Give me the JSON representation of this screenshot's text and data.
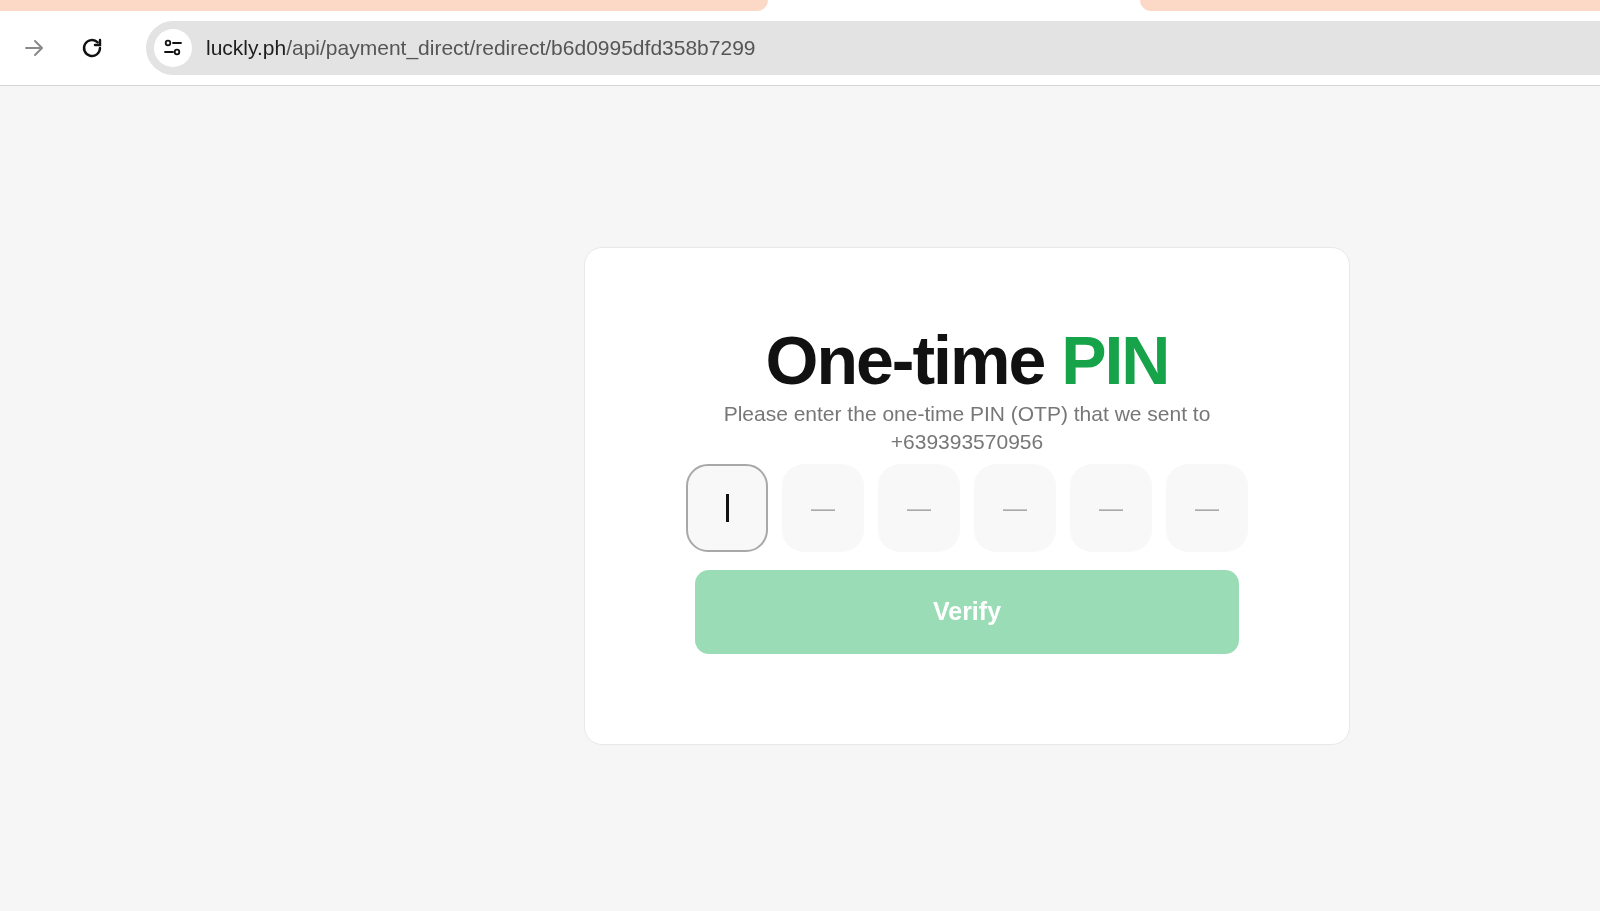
{
  "browser": {
    "address": {
      "domain": "luckly.ph",
      "path": "/api/payment_direct/redirect/b6d0995dfd358b7299"
    },
    "forward_disabled": true
  },
  "otp_card": {
    "title": "One-time",
    "title_highlight": "PIN",
    "instructions": "Please enter the one-time PIN (OTP) that we sent to",
    "phone": "+639393570956",
    "pin_fields": [
      {
        "focused": true
      },
      {
        "focused": false,
        "placeholder": "—"
      },
      {
        "focused": false,
        "placeholder": "—"
      },
      {
        "focused": false,
        "placeholder": "—"
      },
      {
        "focused": false,
        "placeholder": "—"
      },
      {
        "focused": false,
        "placeholder": "—"
      }
    ],
    "verify_button": {
      "label": "Verify",
      "disabled": true
    }
  }
}
